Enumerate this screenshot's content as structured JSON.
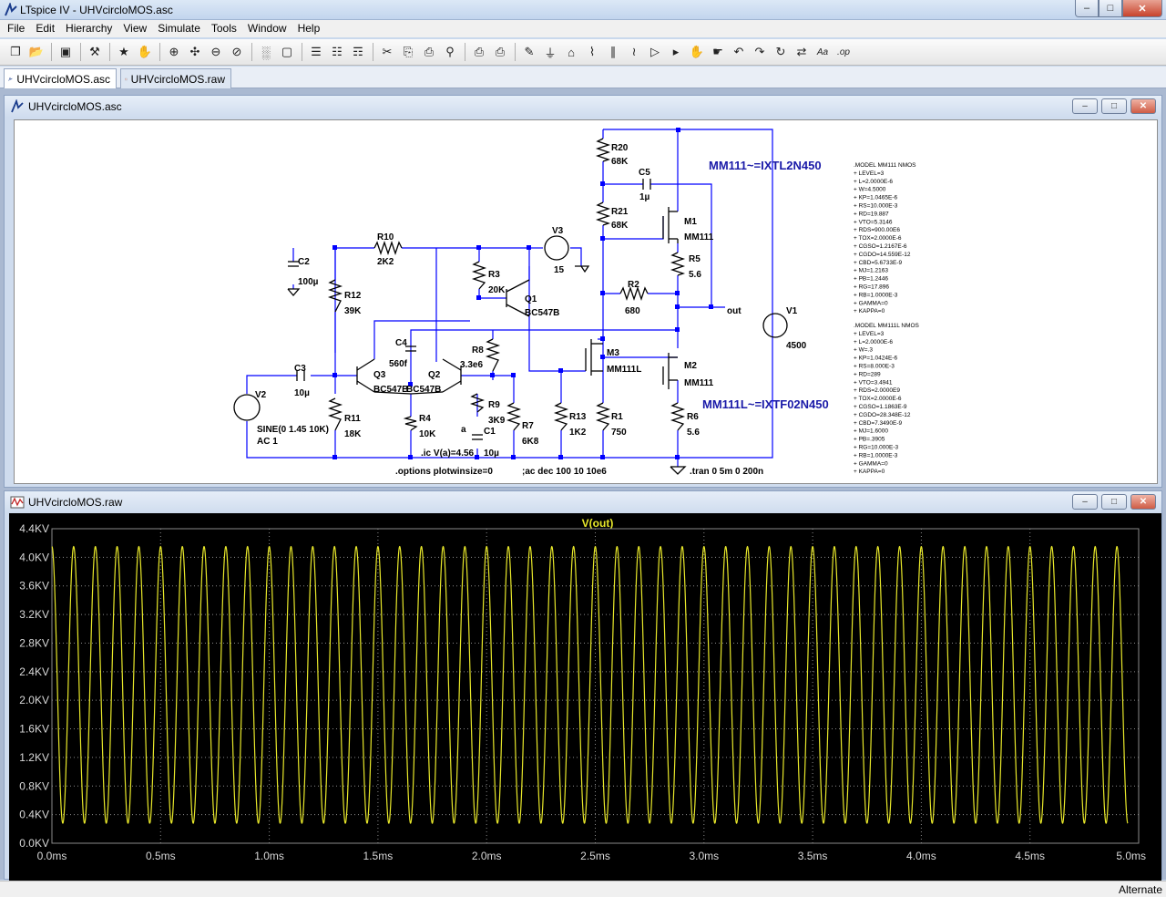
{
  "window": {
    "title": "LTspice IV - UHVcircloMOS.asc",
    "min_glyph": "–",
    "max_glyph": "□",
    "close_glyph": "✕"
  },
  "menu": [
    {
      "label": "File"
    },
    {
      "label": "Edit"
    },
    {
      "label": "Hierarchy"
    },
    {
      "label": "View"
    },
    {
      "label": "Simulate"
    },
    {
      "label": "Tools"
    },
    {
      "label": "Window"
    },
    {
      "label": "Help"
    }
  ],
  "toolbar": {
    "groups": [
      [
        "new-schematic-icon",
        "open-icon"
      ],
      [
        "save-icon"
      ],
      [
        "control-panel-icon"
      ],
      [
        "run-icon",
        "halt-icon"
      ],
      [
        "zoom-in-icon",
        "pan-icon",
        "zoom-out-icon",
        "zoom-cancel-icon"
      ],
      [
        "autorange-icon",
        "zoom-full-icon"
      ],
      [
        "tile-horizontal-icon",
        "cascade-icon",
        "tile-vertical-icon"
      ],
      [
        "cut-icon",
        "copy-icon",
        "paste-icon",
        "find-icon"
      ],
      [
        "print-setup-icon",
        "print-icon"
      ],
      [
        "draw-wire-icon",
        "ground-icon",
        "label-net-icon",
        "resistor-icon",
        "capacitor-icon",
        "inductor-icon",
        "diode-icon",
        "component-icon",
        "move-icon",
        "drag-icon",
        "undo-icon",
        "redo-icon",
        "rotate-icon",
        "mirror-icon",
        "text-icon",
        "spice-directive-icon"
      ]
    ],
    "glyphs": {
      "new-schematic-icon": "❐",
      "open-icon": "📂",
      "save-icon": "▣",
      "control-panel-icon": "⚒",
      "run-icon": "★",
      "halt-icon": "✋",
      "zoom-in-icon": "⊕",
      "pan-icon": "✣",
      "zoom-out-icon": "⊖",
      "zoom-cancel-icon": "⊘",
      "autorange-icon": "░",
      "zoom-full-icon": "▢",
      "tile-horizontal-icon": "☰",
      "cascade-icon": "☷",
      "tile-vertical-icon": "☶",
      "cut-icon": "✂",
      "copy-icon": "⎘",
      "paste-icon": "⎙",
      "find-icon": "⚲",
      "print-setup-icon": "⎙",
      "print-icon": "⎙",
      "draw-wire-icon": "✎",
      "ground-icon": "⏚",
      "label-net-icon": "⌂",
      "resistor-icon": "⌇",
      "capacitor-icon": "∥",
      "inductor-icon": "≀",
      "diode-icon": "▷",
      "component-icon": "▸",
      "move-icon": "✋",
      "drag-icon": "☛",
      "undo-icon": "↶",
      "redo-icon": "↷",
      "rotate-icon": "↻",
      "mirror-icon": "⇄",
      "text-icon": "Aa",
      "spice-directive-icon": ".op"
    }
  },
  "tabs": [
    {
      "label": "UHVcircloMOS.asc",
      "active": true
    },
    {
      "label": "UHVcircloMOS.raw",
      "active": false
    }
  ],
  "schematic_window": {
    "title": "UHVcircloMOS.asc",
    "labels": {
      "R20": "R20",
      "R20v": "68K",
      "R21": "R21",
      "R21v": "68K",
      "C5": "C5",
      "C5v": "1µ",
      "M1": "M1",
      "M1v": "MM111",
      "R5": "R5",
      "R5v": "5.6",
      "R2": "R2",
      "R2v": "680",
      "out": "out",
      "V1": "V1",
      "V1v": "4500",
      "M3": "M3",
      "M3v": "MM111L",
      "M2": "M2",
      "M2v": "MM111",
      "R1": "R1",
      "R1v": "750",
      "R6": "R6",
      "R6v": "5.6",
      "R13": "R13",
      "R13v": "1K2",
      "V3": "V3",
      "V3v": "15",
      "R10": "R10",
      "R10v": "2K2",
      "C2": "C2",
      "C2v": "100µ",
      "R12": "R12",
      "R12v": "39K",
      "R3": "R3",
      "R3v": "20K",
      "Q1": "Q1",
      "Q1v": "BC547B",
      "C4": "C4",
      "C4v": "560f",
      "R8": "R8",
      "R8v": "3.3e6",
      "Q3": "Q3",
      "Q3v": "BC547B",
      "Q2": "Q2",
      "Q2v": "BC547B",
      "C3": "C3",
      "C3v": "10µ",
      "V2": "V2",
      "V2v1": "SINE(0 1.45 10K)",
      "V2v2": "AC 1",
      "R11": "R11",
      "R11v": "18K",
      "R4": "R4",
      "R4v": "10K",
      "R9": "R9",
      "R9v": "3K9",
      "a": "a",
      "C1": "C1",
      "C1v": "10µ",
      "R7": "R7",
      "R7v": "6K8",
      "ic": ".ic V(a)=4.56",
      "options": ".options plotwinsize=0",
      "ac": ";ac dec 100 10 10e6",
      "tran": ".tran 0 5m 0 200n",
      "note1": "MM111~=IXTL2N450",
      "note2": "MM111L~=IXTF02N450"
    },
    "model1": [
      ".MODEL MM111 NMOS",
      "+ LEVEL=3",
      "+ L=2.0000E-6",
      "+ W=4.5000",
      "+ KP=1.0465E-6",
      "+ RS=10.000E-3",
      "+ RD=19.887",
      "+ VTO=5.3146",
      "+ RDS=900.00E6",
      "+ TOX=2.0000E-6",
      "+ CGSO=1.2167E-6",
      "+ CGDO=14.559E-12",
      "+ CBD=5.6733E-9",
      "+ MJ=1.2163",
      "+ PB=1.2446",
      "+ RG=17.896",
      "+ RB=1.0000E-3",
      "+ GAMMA=0",
      "+ KAPPA=0"
    ],
    "model2": [
      ".MODEL MM111L NMOS",
      "+ LEVEL=3",
      "+ L=2.0000E-6",
      "+ W=.3",
      "+ KP=1.0424E-6",
      "+ RS=8.000E-3",
      "+ RD=289",
      "+ VTO=3.4941",
      "+ RDS=2.0000E9",
      "+ TOX=2.0000E-6",
      "+ CGSO=1.1863E-9",
      "+ CGDO=28.348E-12",
      "+ CBD=7.3490E-9",
      "+ MJ=1.6000",
      "+ PB=.3905",
      "+ RG=10.000E-3",
      "+ RB=1.0000E-3",
      "+ GAMMA=0",
      "+ KAPPA=0"
    ]
  },
  "plot_window": {
    "title": "UHVcircloMOS.raw"
  },
  "status": {
    "text": "Alternate"
  },
  "colors": {
    "trace": "#e8e82a",
    "grid": "#8a8a8a",
    "axis_text": "#d8d8d8",
    "plot_bg": "#000000",
    "schematic_text": "#000000",
    "note_text": "#1a1aa8",
    "wire": "#0000ff"
  },
  "chart_data": {
    "type": "line",
    "title": "V(out)",
    "xlabel": "",
    "ylabel": "",
    "x_ticks": [
      "0.0ms",
      "0.5ms",
      "1.0ms",
      "1.5ms",
      "2.0ms",
      "2.5ms",
      "3.0ms",
      "3.5ms",
      "4.0ms",
      "4.5ms",
      "5.0ms"
    ],
    "y_ticks": [
      "0.0KV",
      "0.4KV",
      "0.8KV",
      "1.2KV",
      "1.6KV",
      "2.0KV",
      "2.4KV",
      "2.8KV",
      "3.2KV",
      "3.6KV",
      "4.0KV",
      "4.4KV"
    ],
    "xlim": [
      0,
      5
    ],
    "ylim": [
      0,
      4.4
    ],
    "x_unit": "ms",
    "y_unit": "KV",
    "grid": true,
    "series": [
      {
        "name": "V(out)",
        "waveform": "sine",
        "frequency_khz": 10,
        "min_kv": 0.28,
        "max_kv": 4.15,
        "start_ms": 0.0,
        "end_ms": 4.95
      }
    ]
  }
}
